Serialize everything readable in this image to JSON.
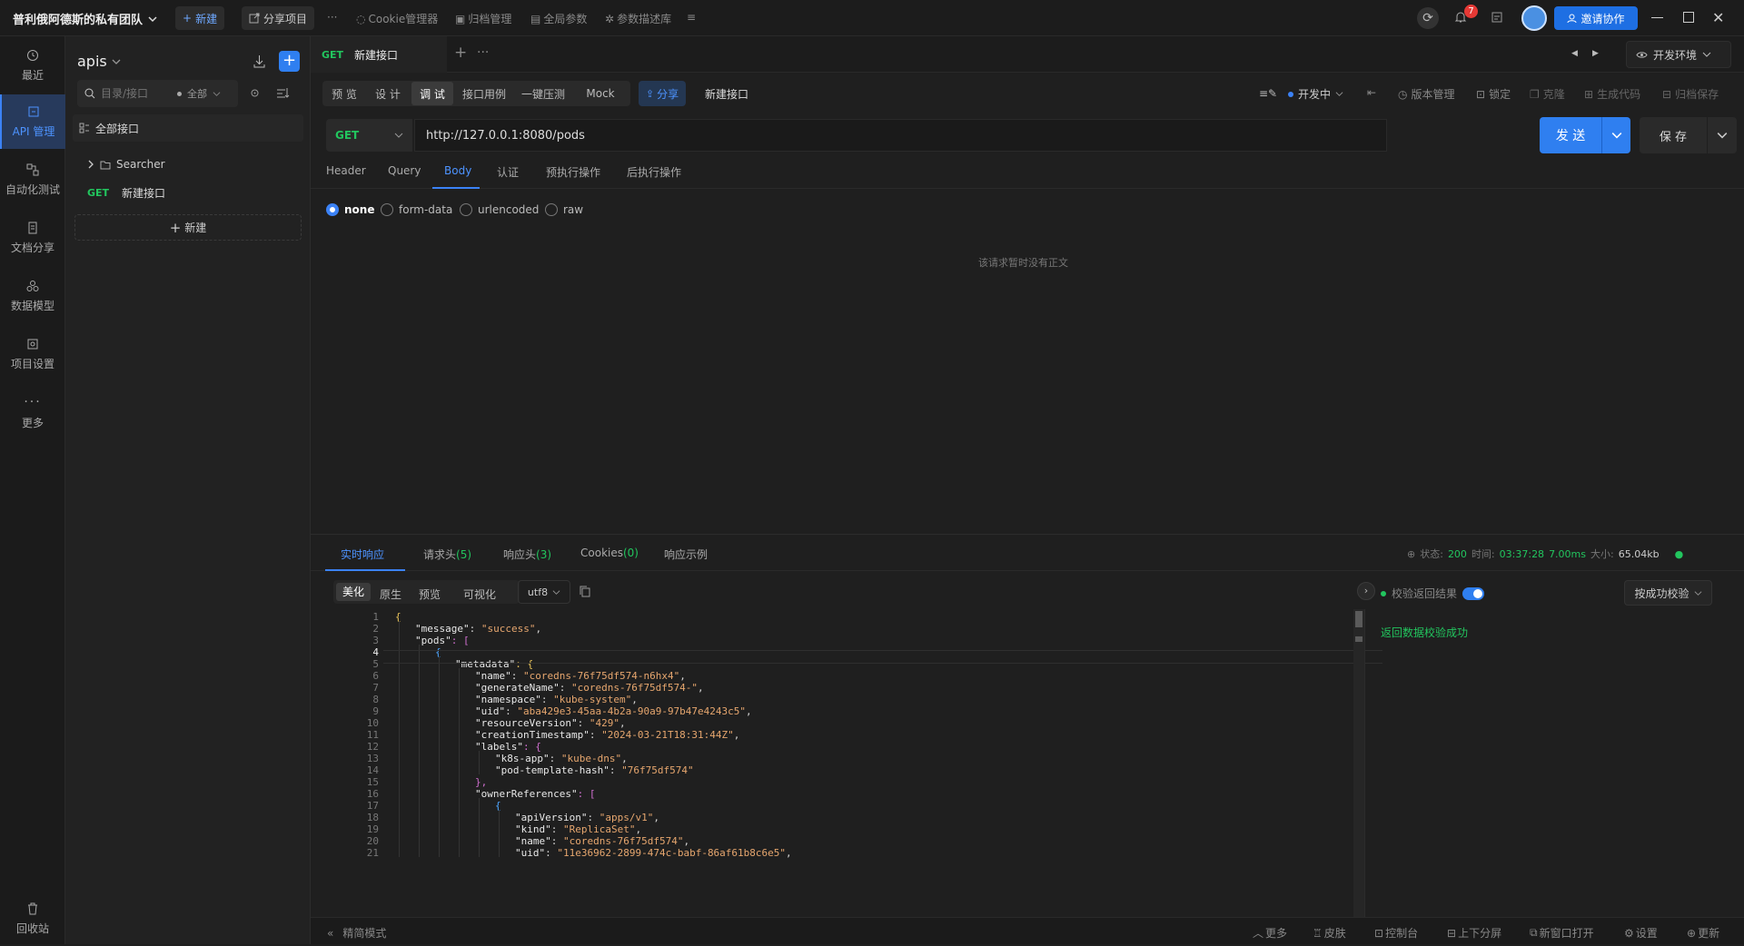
{
  "topbar": {
    "team": "普利俄阿德斯的私有团队",
    "new_btn": "新建",
    "share_project": "分享项目",
    "more": "···",
    "cookie_mgr": "Cookie管理器",
    "archive_mgr": "归档管理",
    "global_params": "全局参数",
    "param_desc": "参数描述库",
    "notif_count": "7",
    "invite": "邀请协作"
  },
  "nav": {
    "recent": "最近",
    "api_mgmt": "API 管理",
    "auto_test": "自动化测试",
    "doc_share": "文档分享",
    "data_model": "数据模型",
    "project_settings": "项目设置",
    "more": "更多",
    "trash": "回收站"
  },
  "tree": {
    "project": "apis",
    "search_placeholder": "目录/接口",
    "filter": "全部",
    "all_apis": "全部接口",
    "folder": "Searcher",
    "item_method": "GET",
    "item_name": "新建接口",
    "new_label": "新建"
  },
  "tab": {
    "method": "GET",
    "name": "新建接口",
    "env": "开发环境"
  },
  "modes": {
    "preview": "预 览",
    "design": "设 计",
    "debug": "调 试",
    "cases": "接口用例",
    "stress": "一键压测",
    "mock": "Mock",
    "share": "分享",
    "api_name": "新建接口",
    "status": "开发中",
    "version": "版本管理",
    "lock": "锁定",
    "clone": "克隆",
    "gen_code": "生成代码",
    "archive": "归档保存"
  },
  "request": {
    "method": "GET",
    "url": "http://127.0.0.1:8080/pods",
    "send": "发 送",
    "save": "保 存"
  },
  "req_tabs": [
    "Header",
    "Query",
    "Body",
    "认证",
    "预执行操作",
    "后执行操作"
  ],
  "body_types": [
    "none",
    "form-data",
    "urlencoded",
    "raw"
  ],
  "body_empty": "该请求暂时没有正文",
  "resp_tabs": {
    "realtime": "实时响应",
    "req_headers": "请求头",
    "req_headers_count": "(5)",
    "resp_headers": "响应头",
    "resp_headers_count": "(3)",
    "cookies": "Cookies",
    "cookies_count": "(0)",
    "example": "响应示例"
  },
  "resp_meta": {
    "status_label": "状态:",
    "status": "200",
    "time_label": "时间:",
    "time": "03:37:28",
    "duration": "7.00ms",
    "size_label": "大小:",
    "size": "65.04kb"
  },
  "view_modes": [
    "美化",
    "原生",
    "预览",
    "可视化"
  ],
  "encoding": "utf8",
  "validation": {
    "label": "校验返回结果",
    "mode": "按成功校验",
    "result": "返回数据校验成功"
  },
  "code_lines": [
    "{",
    "\"message\": \"success\",",
    "\"pods\": [",
    "{",
    "\"metadata\": {",
    "\"name\": \"coredns-76f75df574-n6hx4\",",
    "\"generateName\": \"coredns-76f75df574-\",",
    "\"namespace\": \"kube-system\",",
    "\"uid\": \"aba429e3-45aa-4b2a-90a9-97b47e4243c5\",",
    "\"resourceVersion\": \"429\",",
    "\"creationTimestamp\": \"2024-03-21T18:31:44Z\",",
    "\"labels\": {",
    "\"k8s-app\": \"kube-dns\",",
    "\"pod-template-hash\": \"76f75df574\"",
    "},",
    "\"ownerReferences\": [",
    "{",
    "\"apiVersion\": \"apps/v1\",",
    "\"kind\": \"ReplicaSet\",",
    "\"name\": \"coredns-76f75df574\",",
    "\"uid\": \"11e36962-2899-474c-babf-86af61b8c6e5\","
  ],
  "statusbar": {
    "compact": "精简模式",
    "more": "更多",
    "skin": "皮肤",
    "console": "控制台",
    "split": "上下分屏",
    "new_window": "新窗口打开",
    "settings": "设置",
    "update": "更新"
  }
}
